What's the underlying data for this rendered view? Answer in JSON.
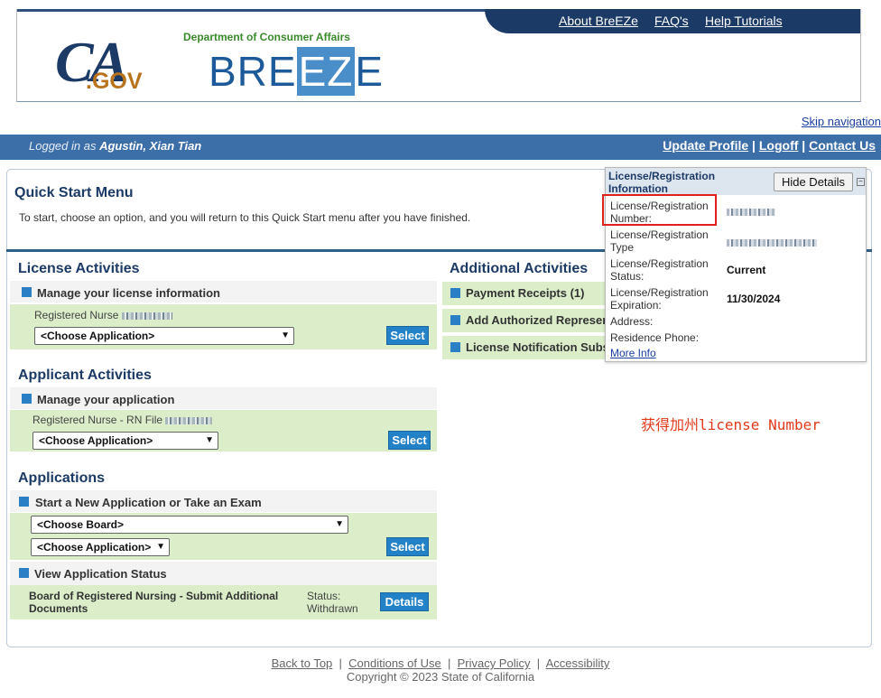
{
  "header": {
    "nav": [
      "About BreEZe",
      "FAQ's",
      "Help Tutorials"
    ],
    "ca_logo_main": "CA",
    "ca_logo_sub": ".GOV",
    "dept": "Department of Consumer Affairs",
    "breeze_a": "BRE",
    "breeze_ez": "EZ",
    "breeze_b": "E"
  },
  "skip_nav": "Skip navigation",
  "userbar": {
    "logged_prefix": "Logged in as",
    "user": "Agustin, Xian Tian",
    "links": [
      "Update Profile",
      "Logoff",
      "Contact Us"
    ]
  },
  "quick_start": {
    "title": "Quick Start Menu",
    "desc": "To start, choose an option, and you will return to this Quick Start menu after you have finished."
  },
  "license_activities": {
    "title": "License Activities",
    "sub": "Manage your license information",
    "item_label": "Registered Nurse",
    "select_value": "<Choose Application>",
    "button": "Select"
  },
  "applicant_activities": {
    "title": "Applicant Activities",
    "sub": "Manage your application",
    "item_label": "Registered Nurse - RN File",
    "select_value": "<Choose Application>",
    "button": "Select"
  },
  "applications": {
    "title": "Applications",
    "sub1": "Start a New Application or Take an Exam",
    "board_value": "<Choose Board>",
    "app_value": "<Choose Application>",
    "button": "Select",
    "sub2": "View Application Status",
    "status_item": "Board of Registered Nursing - Submit Additional Documents",
    "status_label": "Status:",
    "status_value": "Withdrawn",
    "details_button": "Details"
  },
  "additional_activities": {
    "title": "Additional Activities",
    "items": [
      "Payment Receipts (1)",
      "Add Authorized Represen",
      "License Notification Subs"
    ]
  },
  "popup": {
    "title": "License/Registration Information",
    "hide_button": "Hide Details",
    "collapse_glyph": "−",
    "rows": [
      {
        "key": "License/Registration Number:",
        "value": ""
      },
      {
        "key": "License/Registration Type",
        "value": ""
      },
      {
        "key": "License/Registration Status:",
        "value": "Current"
      },
      {
        "key": "License/Registration Expiration:",
        "value": "11/30/2024"
      },
      {
        "key": "Address:",
        "value": ""
      },
      {
        "key": "Residence Phone:",
        "value": ""
      }
    ],
    "more_info": "More Info"
  },
  "annotation": "获得加州license Number",
  "footer": {
    "links": [
      "Back to Top",
      "Conditions of Use",
      "Privacy Policy",
      "Accessibility"
    ],
    "copyright": "Copyright © 2023 State of California"
  },
  "colors": {
    "navy": "#1c3a66",
    "bar": "#3c6ea8",
    "accent_button": "#2382c7",
    "green_row": "#dbeec9",
    "annotation": "#e03a1a"
  }
}
